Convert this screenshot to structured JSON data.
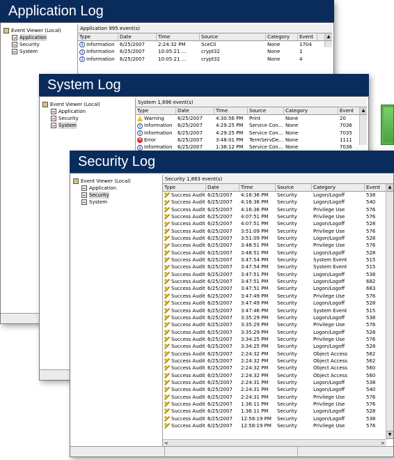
{
  "colors": {
    "titlebar": "#0a2c5c",
    "accent_button": "#56b34a"
  },
  "app_window": {
    "title": "Application Log",
    "tree": [
      {
        "label": "Event Viewer (Local)",
        "icon": "event-viewer-icon"
      },
      {
        "label": "Application",
        "icon": "log-icon",
        "selected": true
      },
      {
        "label": "Security",
        "icon": "log-icon"
      },
      {
        "label": "System",
        "icon": "log-icon"
      }
    ],
    "header": "Application   995 event(s)",
    "columns": [
      "Type",
      "Date",
      "Time",
      "Source",
      "Category",
      "Event"
    ],
    "rows": [
      {
        "type": "Information",
        "icon": "info",
        "date": "6/25/2007",
        "time": "2:24:32 PM",
        "source": "SceCli",
        "category": "None",
        "event": "1704"
      },
      {
        "type": "Information",
        "icon": "info",
        "date": "6/25/2007",
        "time": "10:05:21 ...",
        "source": "crypt32",
        "category": "None",
        "event": "1"
      },
      {
        "type": "Information",
        "icon": "info",
        "date": "6/25/2007",
        "time": "10:05:21 ...",
        "source": "crypt32",
        "category": "None",
        "event": "4"
      }
    ]
  },
  "system_window": {
    "title": "System Log",
    "tree": [
      {
        "label": "Event Viewer (Local)",
        "icon": "event-viewer-icon"
      },
      {
        "label": "Application",
        "icon": "log-icon"
      },
      {
        "label": "Security",
        "icon": "log-icon"
      },
      {
        "label": "System",
        "icon": "log-icon",
        "selected": true
      }
    ],
    "header": "System   1,696 event(s)",
    "columns": [
      "Type",
      "Date",
      "Time",
      "Source",
      "Category",
      "Event"
    ],
    "rows": [
      {
        "type": "Warning",
        "icon": "warn",
        "date": "6/25/2007",
        "time": "4:30:56 PM",
        "source": "Print",
        "category": "None",
        "event": "20"
      },
      {
        "type": "Information",
        "icon": "info",
        "date": "6/25/2007",
        "time": "4:29:25 PM",
        "source": "Service Con...",
        "category": "None",
        "event": "7036"
      },
      {
        "type": "Information",
        "icon": "info",
        "date": "6/25/2007",
        "time": "4:29:25 PM",
        "source": "Service Con...",
        "category": "None",
        "event": "7035"
      },
      {
        "type": "Error",
        "icon": "err",
        "date": "6/25/2007",
        "time": "3:48:01 PM",
        "source": "TermServDe...",
        "category": "None",
        "event": "1111"
      },
      {
        "type": "Information",
        "icon": "info",
        "date": "6/25/2007",
        "time": "1:36:12 PM",
        "source": "Service Con...",
        "category": "None",
        "event": "7036"
      }
    ]
  },
  "security_window": {
    "title": "Security Log",
    "tree": [
      {
        "label": "Event Viewer (Local)",
        "icon": "event-viewer-icon"
      },
      {
        "label": "Application",
        "icon": "log-icon"
      },
      {
        "label": "Security",
        "icon": "log-icon",
        "selected": true
      },
      {
        "label": "System",
        "icon": "log-icon"
      }
    ],
    "header": "Security   1,863 event(s)",
    "columns": [
      "Type",
      "Date",
      "Time",
      "Source",
      "Category",
      "Event"
    ],
    "rows": [
      {
        "type": "Success Audit",
        "icon": "key",
        "date": "6/25/2007",
        "time": "4:16:36 PM",
        "source": "Security",
        "category": "Logon/Logoff",
        "event": "538"
      },
      {
        "type": "Success Audit",
        "icon": "key",
        "date": "6/25/2007",
        "time": "4:16:36 PM",
        "source": "Security",
        "category": "Logon/Logoff",
        "event": "540"
      },
      {
        "type": "Success Audit",
        "icon": "key",
        "date": "6/25/2007",
        "time": "4:16:36 PM",
        "source": "Security",
        "category": "Privilege Use",
        "event": "576"
      },
      {
        "type": "Success Audit",
        "icon": "key",
        "date": "6/25/2007",
        "time": "4:07:51 PM",
        "source": "Security",
        "category": "Privilege Use",
        "event": "576"
      },
      {
        "type": "Success Audit",
        "icon": "key",
        "date": "6/25/2007",
        "time": "4:07:51 PM",
        "source": "Security",
        "category": "Logon/Logoff",
        "event": "528"
      },
      {
        "type": "Success Audit",
        "icon": "key",
        "date": "6/25/2007",
        "time": "3:51:09 PM",
        "source": "Security",
        "category": "Privilege Use",
        "event": "576"
      },
      {
        "type": "Success Audit",
        "icon": "key",
        "date": "6/25/2007",
        "time": "3:51:09 PM",
        "source": "Security",
        "category": "Logon/Logoff",
        "event": "528"
      },
      {
        "type": "Success Audit",
        "icon": "key",
        "date": "6/25/2007",
        "time": "3:48:51 PM",
        "source": "Security",
        "category": "Privilege Use",
        "event": "576"
      },
      {
        "type": "Success Audit",
        "icon": "key",
        "date": "6/25/2007",
        "time": "3:48:51 PM",
        "source": "Security",
        "category": "Logon/Logoff",
        "event": "528"
      },
      {
        "type": "Success Audit",
        "icon": "key",
        "date": "6/25/2007",
        "time": "3:47:54 PM",
        "source": "Security",
        "category": "System Event",
        "event": "515"
      },
      {
        "type": "Success Audit",
        "icon": "key",
        "date": "6/25/2007",
        "time": "3:47:54 PM",
        "source": "Security",
        "category": "System Event",
        "event": "515"
      },
      {
        "type": "Success Audit",
        "icon": "key",
        "date": "6/25/2007",
        "time": "3:47:51 PM",
        "source": "Security",
        "category": "Logon/Logoff",
        "event": "538"
      },
      {
        "type": "Success Audit",
        "icon": "key",
        "date": "6/25/2007",
        "time": "3:47:51 PM",
        "source": "Security",
        "category": "Logon/Logoff",
        "event": "682"
      },
      {
        "type": "Success Audit",
        "icon": "key",
        "date": "6/25/2007",
        "time": "3:47:51 PM",
        "source": "Security",
        "category": "Logon/Logoff",
        "event": "683"
      },
      {
        "type": "Success Audit",
        "icon": "key",
        "date": "6/25/2007",
        "time": "3:47:49 PM",
        "source": "Security",
        "category": "Privilege Use",
        "event": "576"
      },
      {
        "type": "Success Audit",
        "icon": "key",
        "date": "6/25/2007",
        "time": "3:47:49 PM",
        "source": "Security",
        "category": "Logon/Logoff",
        "event": "528"
      },
      {
        "type": "Success Audit",
        "icon": "key",
        "date": "6/25/2007",
        "time": "3:47:46 PM",
        "source": "Security",
        "category": "System Event",
        "event": "515"
      },
      {
        "type": "Success Audit",
        "icon": "key",
        "date": "6/25/2007",
        "time": "3:35:29 PM",
        "source": "Security",
        "category": "Logon/Logoff",
        "event": "538"
      },
      {
        "type": "Success Audit",
        "icon": "key",
        "date": "6/25/2007",
        "time": "3:35:29 PM",
        "source": "Security",
        "category": "Privilege Use",
        "event": "576"
      },
      {
        "type": "Success Audit",
        "icon": "key",
        "date": "6/25/2007",
        "time": "3:35:29 PM",
        "source": "Security",
        "category": "Logon/Logoff",
        "event": "528"
      },
      {
        "type": "Success Audit",
        "icon": "key",
        "date": "6/25/2007",
        "time": "3:34:25 PM",
        "source": "Security",
        "category": "Privilege Use",
        "event": "576"
      },
      {
        "type": "Success Audit",
        "icon": "key",
        "date": "6/25/2007",
        "time": "3:34:25 PM",
        "source": "Security",
        "category": "Logon/Logoff",
        "event": "528"
      },
      {
        "type": "Success Audit",
        "icon": "key",
        "date": "6/25/2007",
        "time": "2:24:32 PM",
        "source": "Security",
        "category": "Object Access",
        "event": "562"
      },
      {
        "type": "Success Audit",
        "icon": "key",
        "date": "6/25/2007",
        "time": "2:24:32 PM",
        "source": "Security",
        "category": "Object Access",
        "event": "562"
      },
      {
        "type": "Success Audit",
        "icon": "key",
        "date": "6/25/2007",
        "time": "2:24:32 PM",
        "source": "Security",
        "category": "Object Access",
        "event": "560"
      },
      {
        "type": "Success Audit",
        "icon": "key",
        "date": "6/25/2007",
        "time": "2:24:32 PM",
        "source": "Security",
        "category": "Object Access",
        "event": "560"
      },
      {
        "type": "Success Audit",
        "icon": "key",
        "date": "6/25/2007",
        "time": "2:24:31 PM",
        "source": "Security",
        "category": "Logon/Logoff",
        "event": "538"
      },
      {
        "type": "Success Audit",
        "icon": "key",
        "date": "6/25/2007",
        "time": "2:24:31 PM",
        "source": "Security",
        "category": "Logon/Logoff",
        "event": "540"
      },
      {
        "type": "Success Audit",
        "icon": "key",
        "date": "6/25/2007",
        "time": "2:24:31 PM",
        "source": "Security",
        "category": "Privilege Use",
        "event": "576"
      },
      {
        "type": "Success Audit",
        "icon": "key",
        "date": "6/25/2007",
        "time": "1:36:11 PM",
        "source": "Security",
        "category": "Privilege Use",
        "event": "576"
      },
      {
        "type": "Success Audit",
        "icon": "key",
        "date": "6/25/2007",
        "time": "1:36:11 PM",
        "source": "Security",
        "category": "Logon/Logoff",
        "event": "528"
      },
      {
        "type": "Success Audit",
        "icon": "key",
        "date": "6/25/2007",
        "time": "12:58:19 PM",
        "source": "Security",
        "category": "Logon/Logoff",
        "event": "538"
      },
      {
        "type": "Success Audit",
        "icon": "key",
        "date": "6/25/2007",
        "time": "12:58:19 PM",
        "source": "Security",
        "category": "Privilege Use",
        "event": "576"
      }
    ]
  }
}
